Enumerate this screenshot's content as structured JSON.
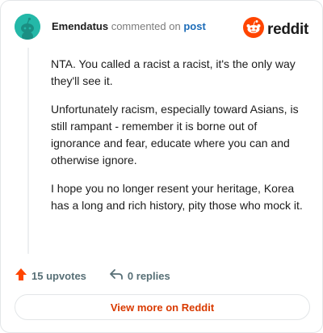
{
  "header": {
    "username": "Emendatus",
    "action_text": "commented on",
    "post_link": "post"
  },
  "brand": {
    "name": "reddit",
    "logo_icon": "reddit-snoo-icon",
    "accent_color": "#ff4500"
  },
  "avatar": {
    "icon": "snoo-avatar-icon",
    "color": "#24b8a8"
  },
  "comment": {
    "paragraphs": [
      "NTA. You called a racist a racist, it's the only way they'll see it.",
      "Unfortunately racism, especially toward Asians, is still rampant - remember it is borne out of ignorance and fear, educate where you can and otherwise ignore.",
      "I hope you no longer resent your heritage, Korea has a long and rich history, pity those who mock it."
    ]
  },
  "actions": {
    "upvotes": "15 upvotes",
    "upvote_icon": "upvote-arrow-icon",
    "replies": "0 replies",
    "reply_icon": "reply-icon"
  },
  "view_more": {
    "label": "View more on Reddit",
    "color": "#d93a00"
  }
}
